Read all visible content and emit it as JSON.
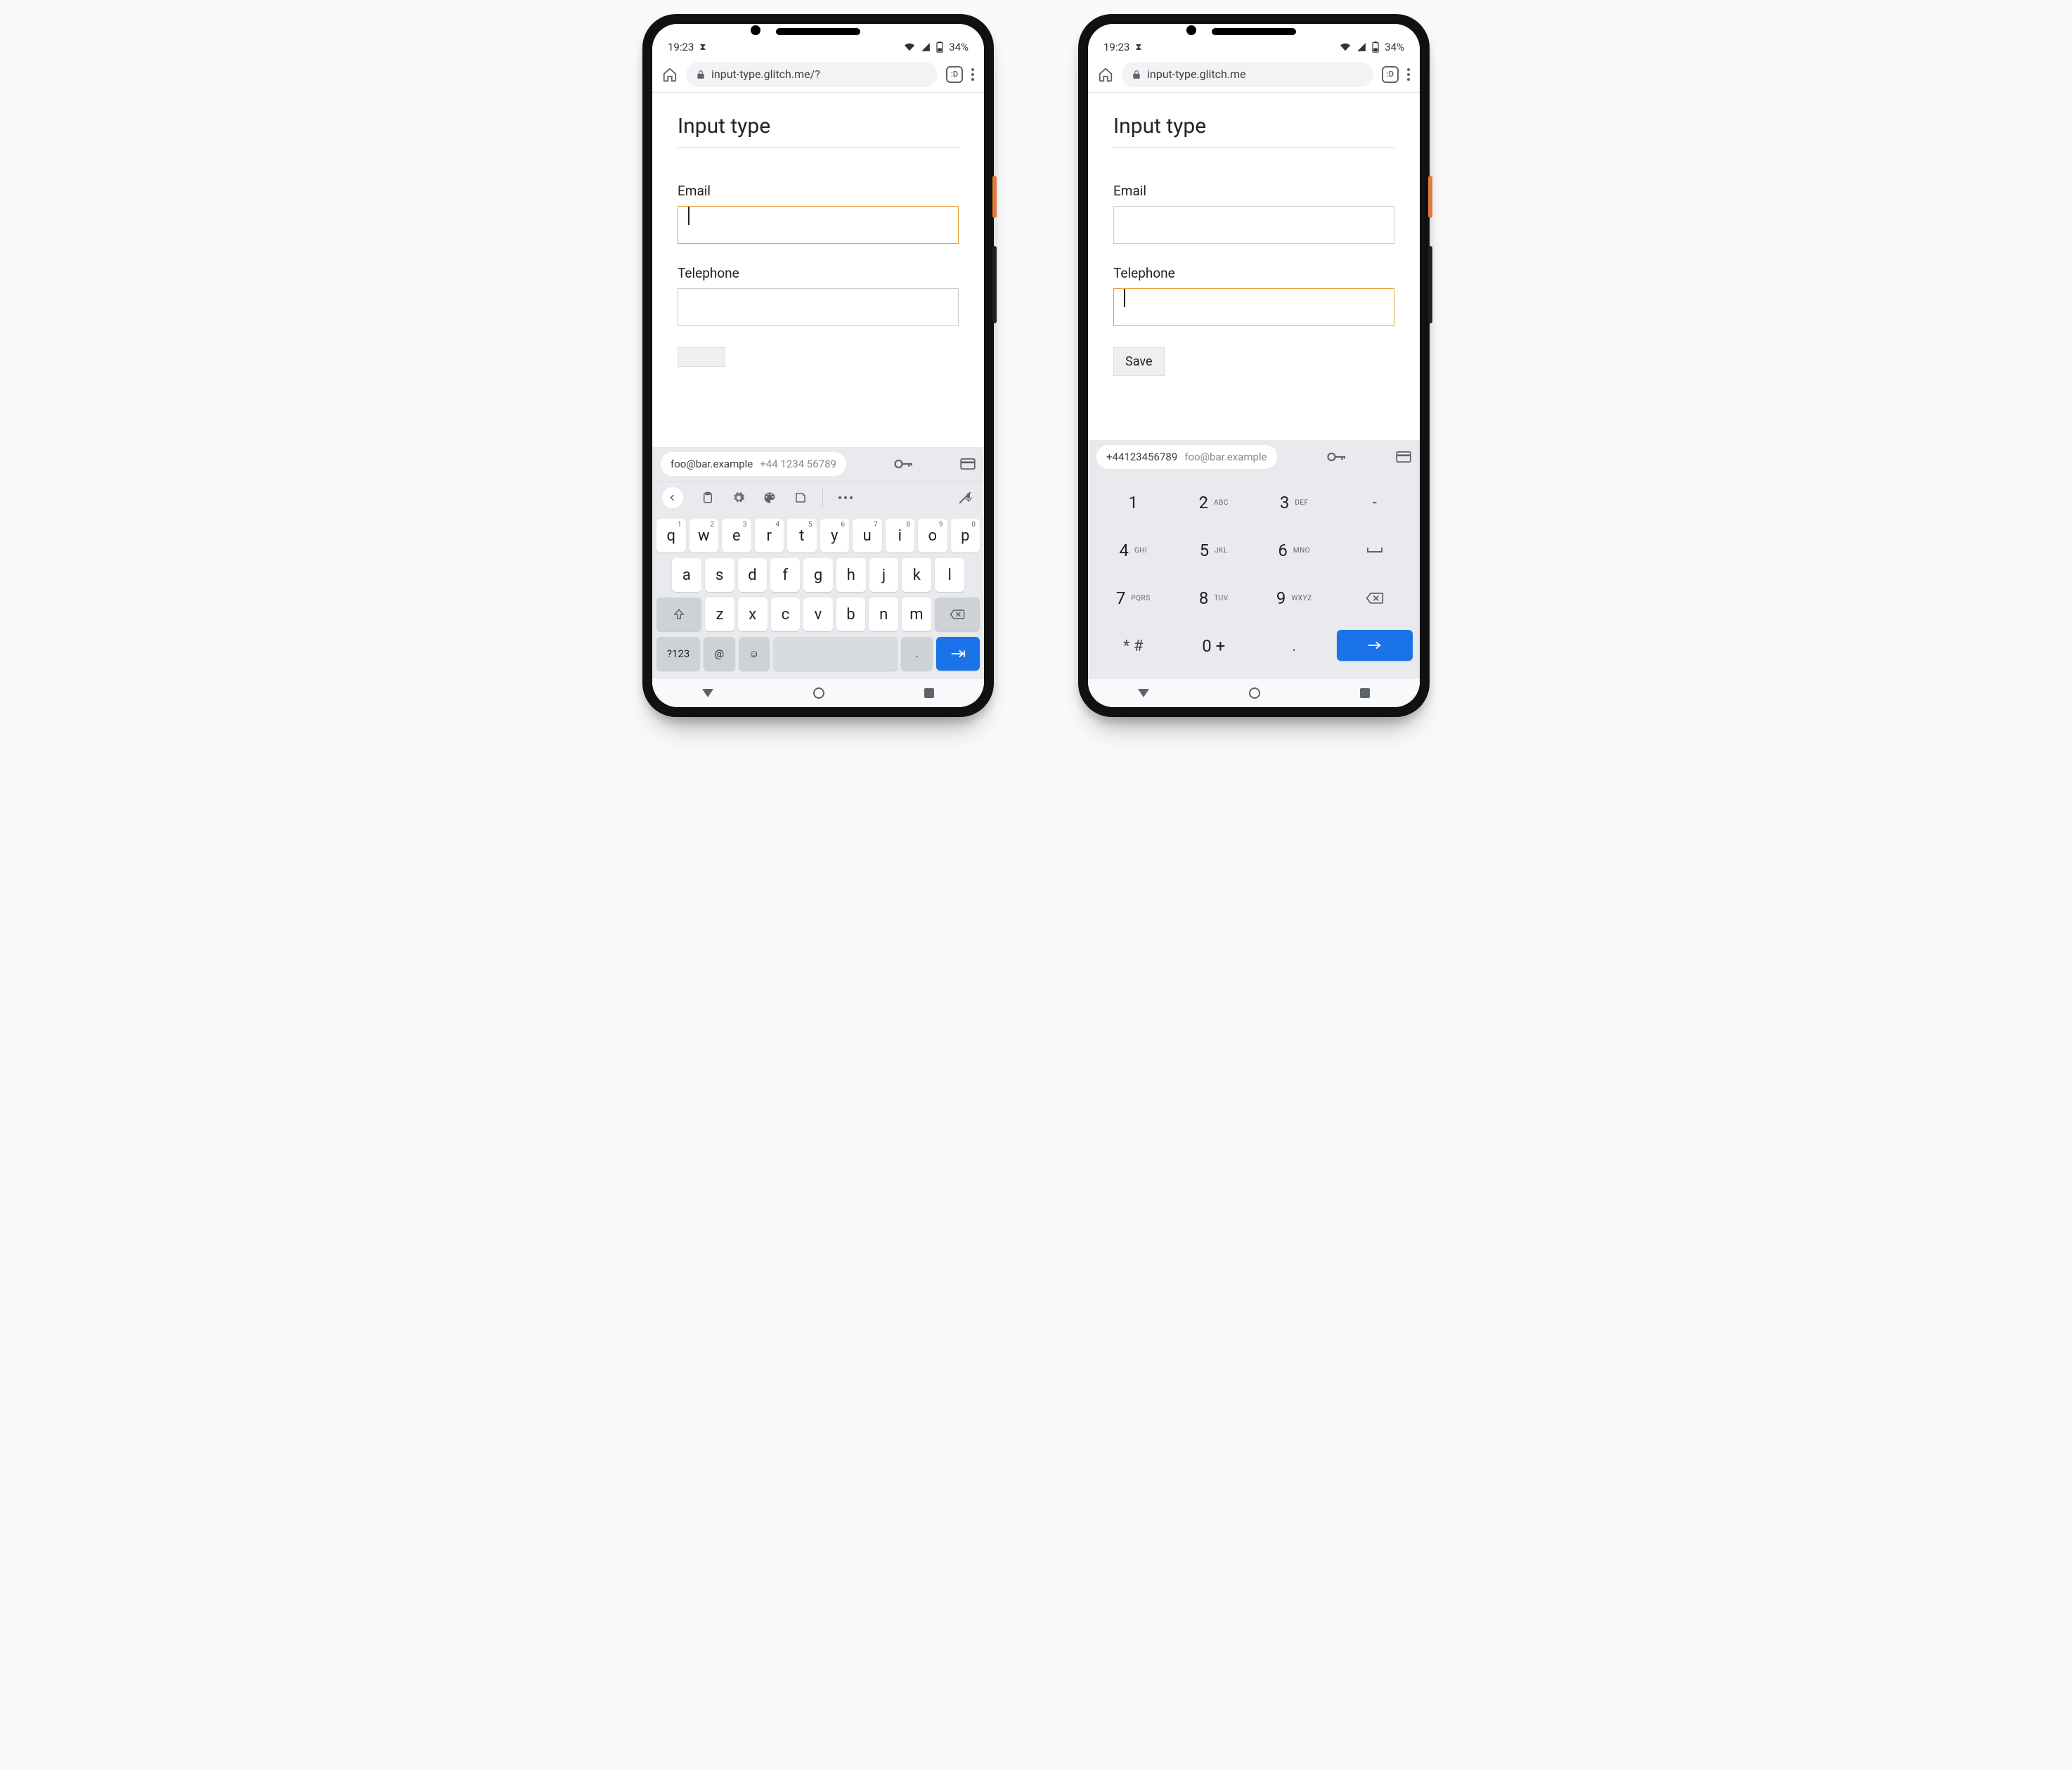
{
  "status": {
    "time": "19:23",
    "battery": "34%"
  },
  "phone_left": {
    "url": "input-type.glitch.me/?",
    "tab_label": ":D",
    "page": {
      "title": "Input type",
      "email_label": "Email",
      "telephone_label": "Telephone",
      "email_value": "",
      "telephone_value": "",
      "focused_field": "email"
    },
    "suggestion": {
      "primary": "foo@bar.example",
      "secondary": "+44 1234 56789"
    },
    "keyboard": {
      "row1": [
        {
          "k": "q",
          "s": "1"
        },
        {
          "k": "w",
          "s": "2"
        },
        {
          "k": "e",
          "s": "3"
        },
        {
          "k": "r",
          "s": "4"
        },
        {
          "k": "t",
          "s": "5"
        },
        {
          "k": "y",
          "s": "6"
        },
        {
          "k": "u",
          "s": "7"
        },
        {
          "k": "i",
          "s": "8"
        },
        {
          "k": "o",
          "s": "9"
        },
        {
          "k": "p",
          "s": "0"
        }
      ],
      "row2": [
        "a",
        "s",
        "d",
        "f",
        "g",
        "h",
        "j",
        "k",
        "l"
      ],
      "row3": [
        "z",
        "x",
        "c",
        "v",
        "b",
        "n",
        "m"
      ],
      "sym": "?123",
      "at": "@",
      "period": "."
    }
  },
  "phone_right": {
    "url": "input-type.glitch.me",
    "tab_label": ":D",
    "page": {
      "title": "Input type",
      "email_label": "Email",
      "telephone_label": "Telephone",
      "email_value": "",
      "telephone_value": "",
      "focused_field": "telephone",
      "save_label": "Save"
    },
    "suggestion": {
      "primary": "+44123456789",
      "secondary": "foo@bar.example"
    },
    "numpad": {
      "rows": [
        [
          {
            "n": "1",
            "l": ""
          },
          {
            "n": "2",
            "l": "ABC"
          },
          {
            "n": "3",
            "l": "DEF"
          },
          {
            "n": "-",
            "l": "",
            "util": true
          }
        ],
        [
          {
            "n": "4",
            "l": "GHI"
          },
          {
            "n": "5",
            "l": "JKL"
          },
          {
            "n": "6",
            "l": "MNO"
          },
          {
            "n": "␣",
            "l": "",
            "util": true,
            "space": true
          }
        ],
        [
          {
            "n": "7",
            "l": "PQRS"
          },
          {
            "n": "8",
            "l": "TUV"
          },
          {
            "n": "9",
            "l": "WXYZ"
          },
          {
            "n": "⌫",
            "l": "",
            "util": true,
            "back": true
          }
        ]
      ],
      "row4": [
        "* #",
        "0 +",
        "."
      ]
    }
  }
}
